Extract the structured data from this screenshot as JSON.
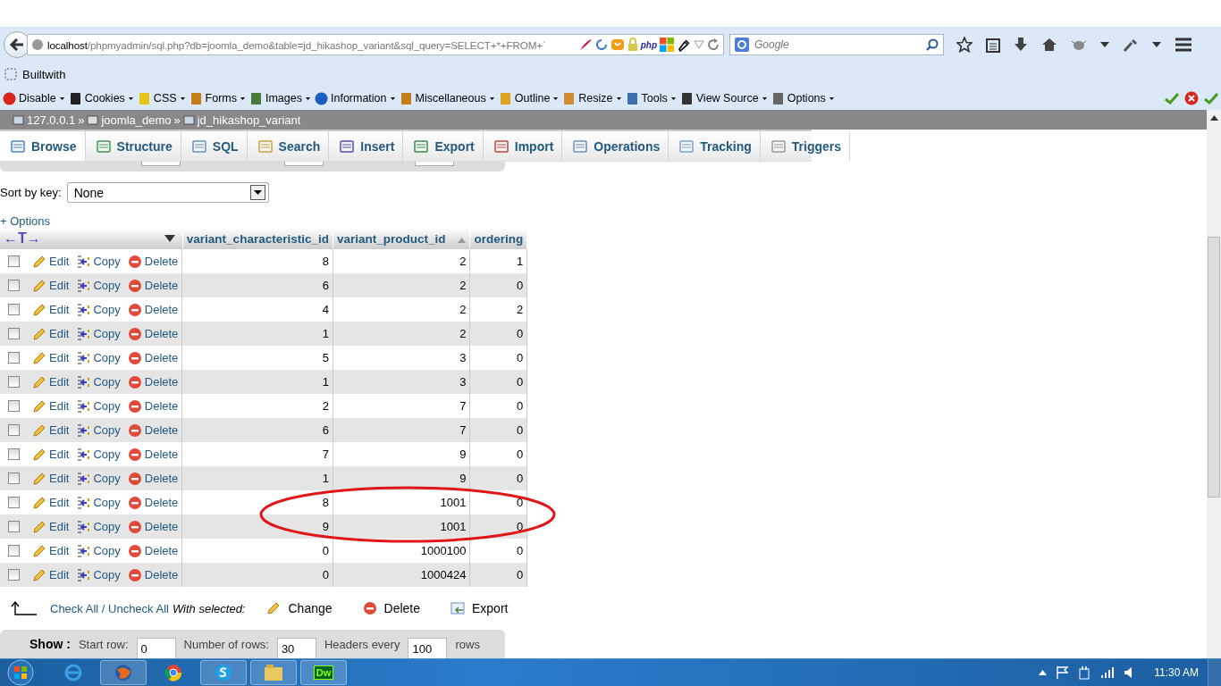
{
  "browser": {
    "url": {
      "host": "localhost",
      "path": "/phpmyadmin/sql.php?db=joomla_demo&table=jd_hikashop_variant&sql_query=SELECT+*+FROM+`"
    },
    "addon_badge": "php",
    "search": {
      "placeholder": "Google"
    }
  },
  "bookmarks": [
    {
      "label": "Builtwith"
    }
  ],
  "devtoolbar": [
    {
      "label": "Disable"
    },
    {
      "label": "Cookies"
    },
    {
      "label": "CSS"
    },
    {
      "label": "Forms"
    },
    {
      "label": "Images"
    },
    {
      "label": "Information"
    },
    {
      "label": "Miscellaneous"
    },
    {
      "label": "Outline"
    },
    {
      "label": "Resize"
    },
    {
      "label": "Tools"
    },
    {
      "label": "View Source"
    },
    {
      "label": "Options"
    }
  ],
  "breadcrumb": [
    "127.0.0.1",
    "joomla_demo",
    "jd_hikashop_variant"
  ],
  "breadcrumb_separator": "»",
  "tabs": [
    {
      "label": "Browse",
      "selected": true
    },
    {
      "label": "Structure",
      "selected": false
    },
    {
      "label": "SQL",
      "selected": false
    },
    {
      "label": "Search",
      "selected": false
    },
    {
      "label": "Insert",
      "selected": false
    },
    {
      "label": "Export",
      "selected": false
    },
    {
      "label": "Import",
      "selected": false
    },
    {
      "label": "Operations",
      "selected": false
    },
    {
      "label": "Tracking",
      "selected": false
    },
    {
      "label": "Triggers",
      "selected": false
    }
  ],
  "sort_by_key": {
    "label": "Sort by key:",
    "value": "None"
  },
  "options_link": "+ Options",
  "table": {
    "resize_handle": "←T→",
    "columns": [
      "variant_characteristic_id",
      "variant_product_id",
      "ordering"
    ],
    "rows": [
      {
        "checked": false,
        "circled": false,
        "actions": [
          "Edit",
          "Copy",
          "Delete"
        ],
        "cells": [
          "8",
          "2",
          "1"
        ]
      },
      {
        "checked": false,
        "circled": false,
        "actions": [
          "Edit",
          "Copy",
          "Delete"
        ],
        "cells": [
          "6",
          "2",
          "0"
        ]
      },
      {
        "checked": false,
        "circled": false,
        "actions": [
          "Edit",
          "Copy",
          "Delete"
        ],
        "cells": [
          "4",
          "2",
          "2"
        ]
      },
      {
        "checked": false,
        "circled": false,
        "actions": [
          "Edit",
          "Copy",
          "Delete"
        ],
        "cells": [
          "1",
          "2",
          "0"
        ]
      },
      {
        "checked": false,
        "circled": false,
        "actions": [
          "Edit",
          "Copy",
          "Delete"
        ],
        "cells": [
          "5",
          "3",
          "0"
        ]
      },
      {
        "checked": false,
        "circled": false,
        "actions": [
          "Edit",
          "Copy",
          "Delete"
        ],
        "cells": [
          "1",
          "3",
          "0"
        ]
      },
      {
        "checked": false,
        "circled": false,
        "actions": [
          "Edit",
          "Copy",
          "Delete"
        ],
        "cells": [
          "2",
          "7",
          "0"
        ]
      },
      {
        "checked": false,
        "circled": false,
        "actions": [
          "Edit",
          "Copy",
          "Delete"
        ],
        "cells": [
          "6",
          "7",
          "0"
        ]
      },
      {
        "checked": false,
        "circled": false,
        "actions": [
          "Edit",
          "Copy",
          "Delete"
        ],
        "cells": [
          "7",
          "9",
          "0"
        ]
      },
      {
        "checked": false,
        "circled": false,
        "actions": [
          "Edit",
          "Copy",
          "Delete"
        ],
        "cells": [
          "1",
          "9",
          "0"
        ]
      },
      {
        "checked": false,
        "circled": true,
        "actions": [
          "Edit",
          "Copy",
          "Delete"
        ],
        "cells": [
          "8",
          "1001",
          "0"
        ]
      },
      {
        "checked": false,
        "circled": true,
        "actions": [
          "Edit",
          "Copy",
          "Delete"
        ],
        "cells": [
          "9",
          "1001",
          "0"
        ]
      },
      {
        "checked": false,
        "circled": false,
        "actions": [
          "Edit",
          "Copy",
          "Delete"
        ],
        "cells": [
          "0",
          "1000100",
          "0"
        ]
      },
      {
        "checked": false,
        "circled": false,
        "actions": [
          "Edit",
          "Copy",
          "Delete"
        ],
        "cells": [
          "0",
          "1000424",
          "0"
        ]
      }
    ]
  },
  "bulk": {
    "check_all": "Check All / Uncheck All",
    "with_selected": "With selected:",
    "actions": [
      "Change",
      "Delete",
      "Export"
    ]
  },
  "show": {
    "label": "Show :",
    "start_row": {
      "label": "Start row:",
      "value": "0"
    },
    "number_of_rows": {
      "label": "Number of rows:",
      "value": "30"
    },
    "headers_every": {
      "label": "Headers every",
      "value": "100"
    },
    "suffix": "rows"
  },
  "taskbar": {
    "dw_label": "Dw",
    "clock": "11:30 AM"
  }
}
